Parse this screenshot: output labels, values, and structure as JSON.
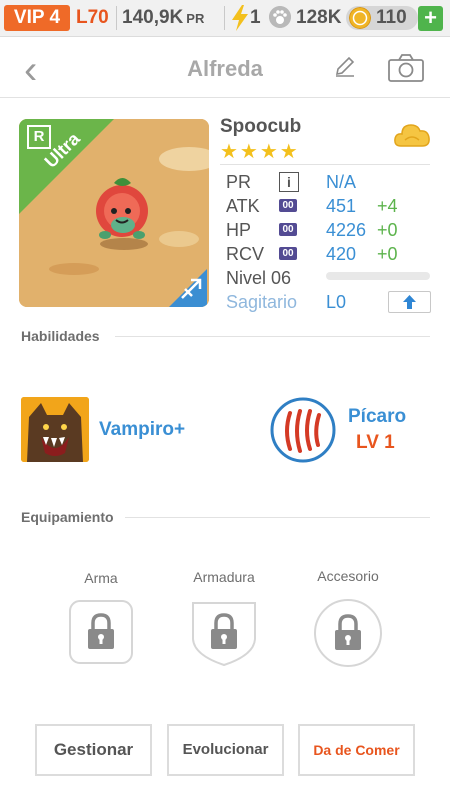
{
  "status_bar": {
    "vip": "VIP 4",
    "level": "L70",
    "power_value": "140,9K",
    "power_unit": "PR",
    "energy": "1",
    "food": "128K",
    "coins": "110",
    "add_button": "+"
  },
  "header": {
    "title": "Alfreda"
  },
  "pet": {
    "rarity_letter": "R",
    "rarity": "Ultra",
    "species": "Spoocub",
    "stars": "★★★★",
    "sign": "Sagitario",
    "level_label": "Nivel 06",
    "level_progress": 0,
    "sign_level": "L0",
    "stats": {
      "pr": {
        "label": "PR",
        "value": "N/A"
      },
      "atk": {
        "label": "ATK",
        "badge": "00",
        "value": "451",
        "bonus": "+4"
      },
      "hp": {
        "label": "HP",
        "badge": "00",
        "value": "4226",
        "bonus": "+0"
      },
      "rcv": {
        "label": "RCV",
        "badge": "00",
        "value": "420",
        "bonus": "+0"
      }
    }
  },
  "skills": {
    "title": "Habilidades",
    "skill1": "Vampiro+",
    "skill2": "Pícaro",
    "skill2_level": "LV 1"
  },
  "equipment": {
    "title": "Equipamiento",
    "weapon": "Arma",
    "armor": "Armadura",
    "accessory": "Accesorio"
  },
  "actions": {
    "manage": "Gestionar",
    "evolve": "Evolucionar",
    "feed": "Da de Comer"
  },
  "colors": {
    "accent_orange": "#e8551e",
    "accent_blue": "#3a8fd4",
    "bonus_green": "#5cb34c",
    "ultra_green": "#6bb54a"
  }
}
